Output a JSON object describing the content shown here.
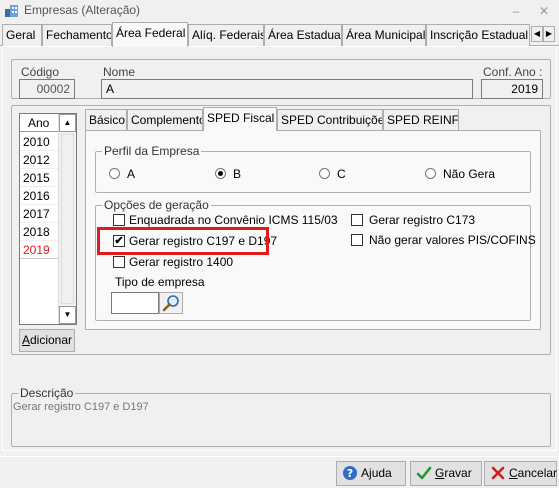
{
  "window": {
    "title": "Empresas (Alteração)"
  },
  "main_tabs": [
    "Geral",
    "Fechamento",
    "Área Federal",
    "Alíq. Federais",
    "Área Estadual",
    "Área Municipal",
    "Inscrição Estadual S"
  ],
  "header": {
    "codigo_label": "Código",
    "codigo_value": "00002",
    "nome_label": "Nome",
    "nome_value": "A",
    "conf_ano_label": "Conf. Ano :",
    "conf_ano_value": "2019"
  },
  "years": {
    "header": "Ano",
    "items": [
      "2010",
      "2012",
      "2015",
      "2016",
      "2017",
      "2018",
      "2019"
    ],
    "selected": "2019",
    "add_button": "Adicionar",
    "add_hotkey": "A",
    "add_rest": "dicionar"
  },
  "sub_tabs": [
    "Básico",
    "Complemento",
    "SPED Fiscal",
    "SPED Contribuições",
    "SPED REINF"
  ],
  "perfil": {
    "title": "Perfil da Empresa",
    "options": [
      "A",
      "B",
      "C",
      "Não Gera"
    ],
    "selected": "B"
  },
  "opcoes": {
    "title": "Opções de geração",
    "enquadrada": "Enquadrada no Convênio ICMS 115/03",
    "c197": "Gerar registro C197 e D197",
    "r1400": "Gerar registro 1400",
    "c173": "Gerar registro C173",
    "nao_pis": "Não gerar valores PIS/COFINS",
    "c197_checked": true
  },
  "tipo_empresa": {
    "label": "Tipo de empresa",
    "value": ""
  },
  "descricao": {
    "label": "Descrição",
    "text": "Gerar registro C197 e D197"
  },
  "actions": {
    "ajuda_hotkey": "j",
    "ajuda_pre": "A",
    "ajuda_post": "uda",
    "gravar_hotkey": "G",
    "gravar_rest": "ravar",
    "cancelar_hotkey": "C",
    "cancelar_rest": "ancelar"
  },
  "colors": {
    "selected_year": "#e21a1a",
    "highlight": "#e21a1a"
  }
}
